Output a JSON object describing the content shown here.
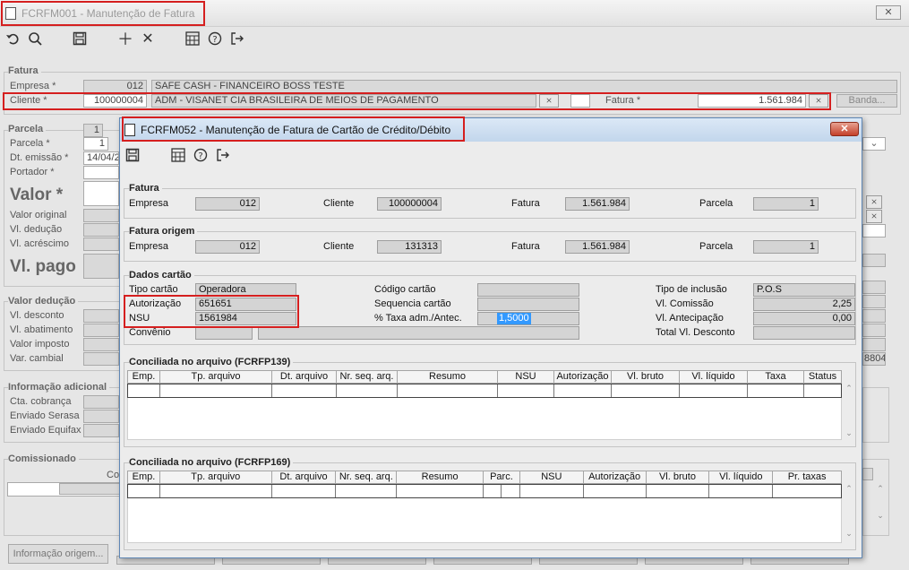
{
  "main": {
    "title": "FCRFM001 - Manutenção de Fatura",
    "close_label": "✕",
    "fatura": {
      "legend": "Fatura",
      "empresa_label": "Empresa *",
      "empresa_code": "012",
      "empresa_name": "SAFE CASH - FINANCEIRO BOSS TESTE",
      "cliente_label": "Cliente *",
      "cliente_code": "100000004",
      "cliente_name": "ADM - VISANET CIA BRASILEIRA DE MEIOS DE PAGAMENTO",
      "fatura_label": "Fatura *",
      "fatura_value": "1.561.984",
      "banda_label": "Banda..."
    },
    "parcela": {
      "legend": "Parcela",
      "parcela_top": "1",
      "parcela_label": "Parcela *",
      "parcela_value": "1",
      "dt_emissao_label": "Dt. emissão *",
      "dt_emissao_value": "14/04/2",
      "portador_label": "Portador *",
      "valor_label": "Valor *",
      "valor_original": "Valor original",
      "vl_deducao": "Vl. dedução",
      "vl_acrescimo": "Vl. acréscimo",
      "vl_pago": "Vl. pago"
    },
    "valor_deducao": {
      "legend": "Valor dedução",
      "vl_desconto": "Vl. desconto",
      "vl_abatimento": "Vl. abatimento",
      "valor_imposto": "Valor imposto",
      "var_cambial": "Var. cambial",
      "right_value": "8804"
    },
    "info": {
      "legend": "Informação adicional",
      "cta_cobranca": "Cta. cobrança",
      "enviado_serasa": "Enviado Serasa",
      "enviado_equifax": "Enviado Equifax"
    },
    "comissionado": {
      "legend": "Comissionado",
      "col_label": "Co"
    },
    "bottom_button": "Informação origem..."
  },
  "dialog": {
    "title": "FCRFM052 - Manutenção de Fatura de Cartão de Crédito/Débito",
    "close_label": "✕",
    "fatura": {
      "legend": "Fatura",
      "empresa_label": "Empresa",
      "empresa_value": "012",
      "cliente_label": "Cliente",
      "cliente_value": "100000004",
      "fatura_label": "Fatura",
      "fatura_value": "1.561.984",
      "parcela_label": "Parcela",
      "parcela_value": "1"
    },
    "fatura_origem": {
      "legend": "Fatura origem",
      "empresa_label": "Empresa",
      "empresa_value": "012",
      "cliente_label": "Cliente",
      "cliente_value": "131313",
      "fatura_label": "Fatura",
      "fatura_value": "1.561.984",
      "parcela_label": "Parcela",
      "parcela_value": "1"
    },
    "dados_cartao": {
      "legend": "Dados cartão",
      "tipo_cartao_label": "Tipo cartão",
      "tipo_cartao_value": "Operadora",
      "autorizacao_label": "Autorização",
      "autorizacao_value": "651651",
      "nsu_label": "NSU",
      "nsu_value": "1561984",
      "convenio_label": "Convênio",
      "codigo_cartao_label": "Código cartão",
      "sequencia_cartao_label": "Sequencia cartão",
      "taxa_label": "% Taxa adm./Antec.",
      "taxa_value": "1,5000",
      "tipo_inclusao_label": "Tipo de inclusão",
      "tipo_inclusao_value": "P.O.S",
      "vl_comissao_label": "Vl. Comissão",
      "vl_comissao_value": "2,25",
      "vl_antecipacao_label": "Vl. Antecipação",
      "vl_antecipacao_value": "0,00",
      "total_desconto_label": "Total Vl. Desconto"
    },
    "grid1": {
      "legend": "Conciliada no arquivo (FCRFP139)",
      "columns": [
        "Emp.",
        "Tp. arquivo",
        "Dt. arquivo",
        "Nr. seq. arq.",
        "Resumo",
        "NSU",
        "Autorização",
        "Vl. bruto",
        "Vl. líquido",
        "Taxa",
        "Status"
      ]
    },
    "grid2": {
      "legend": "Conciliada no arquivo (FCRFP169)",
      "columns": [
        "Emp.",
        "Tp. arquivo",
        "Dt. arquivo",
        "Nr. seq. arq.",
        "Resumo",
        "Parc.",
        "NSU",
        "Autorização",
        "Vl. bruto",
        "Vl. líquido",
        "Pr. taxas"
      ]
    }
  },
  "colors": {
    "highlight": "#d51f1f",
    "selection": "#3399ff"
  }
}
